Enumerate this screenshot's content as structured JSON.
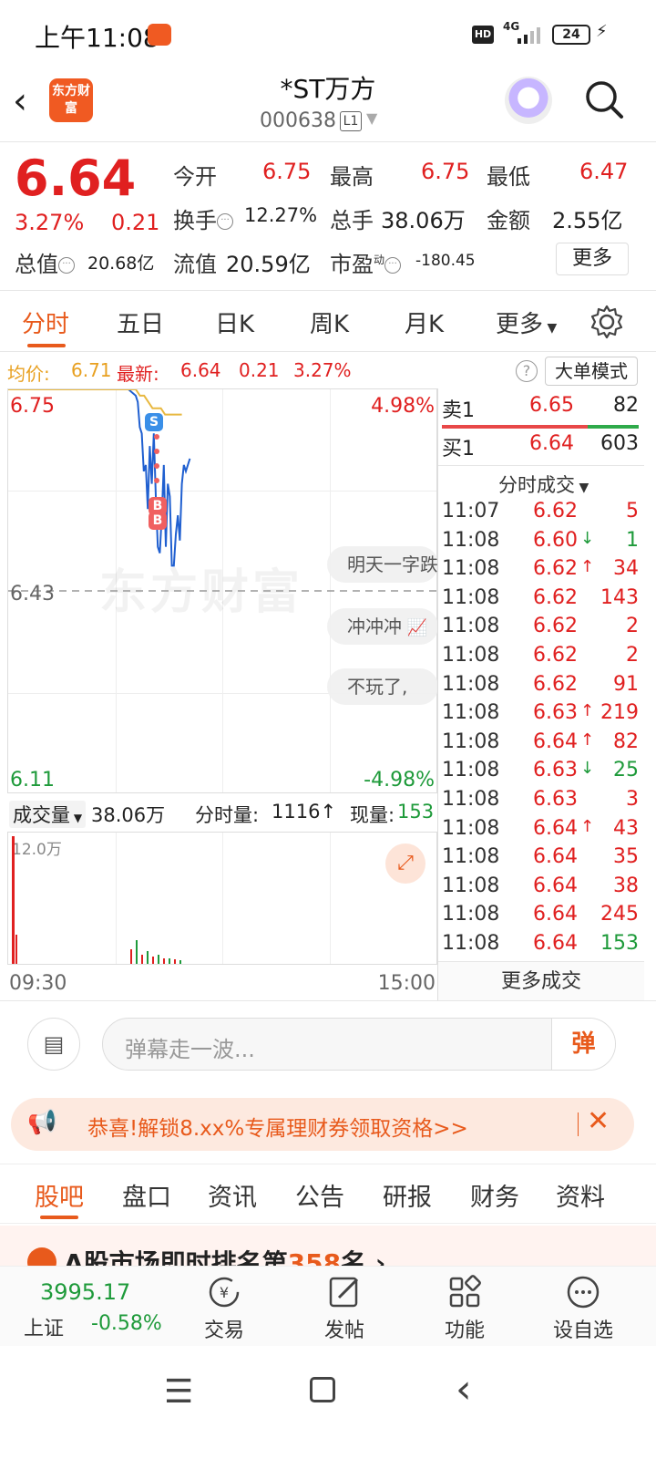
{
  "status": {
    "time": "上午11:08",
    "hd": "HD",
    "network": "4G",
    "battery": "24"
  },
  "header": {
    "logo": "东方财富",
    "name": "*ST万方",
    "code": "000638",
    "level": "L1"
  },
  "quote": {
    "price": "6.64",
    "pct": "3.27%",
    "change": "0.21",
    "open_label": "今开",
    "open": "6.75",
    "high_label": "最高",
    "high": "6.75",
    "low_label": "最低",
    "low": "6.47",
    "turnover_label": "换手",
    "turnover": "12.27%",
    "volume_label": "总手",
    "volume": "38.06万",
    "amount_label": "金额",
    "amount": "2.55亿",
    "mktcap_label": "总值",
    "mktcap": "20.68亿",
    "float_label": "流值",
    "float": "20.59亿",
    "pe_label": "市盈",
    "pe_sup": "动",
    "pe": "-180.45",
    "more": "更多"
  },
  "ktabs": [
    "分时",
    "五日",
    "日K",
    "周K",
    "月K",
    "更多"
  ],
  "avgline": {
    "avg_label": "均价:",
    "avg": "6.71",
    "latest_label": "最新:",
    "latest": "6.64",
    "chg": "0.21",
    "pct": "3.27%",
    "bigorder": "大单模式"
  },
  "chart": {
    "y_top": "6.75",
    "y_mid": "6.43",
    "y_bot": "6.11",
    "pct_top": "4.98%",
    "pct_bot": "-4.98%",
    "watermark": "东方财富",
    "markers": [
      "S",
      "B",
      "B"
    ],
    "comments": [
      "明天一字跌",
      "冲冲冲",
      "不玩了,"
    ]
  },
  "chart_data": {
    "type": "line",
    "ylim": [
      6.11,
      6.75
    ],
    "price": [
      6.75,
      6.75,
      6.75,
      6.75,
      6.75,
      6.75,
      6.75,
      6.74,
      6.73,
      6.69,
      6.68,
      6.62,
      6.63,
      6.56,
      6.66,
      6.6,
      6.68,
      6.58,
      6.5,
      6.49,
      6.55,
      6.63,
      6.5,
      6.6,
      6.58,
      6.47,
      6.47,
      6.52,
      6.55,
      6.51,
      6.6,
      6.63,
      6.62,
      6.63,
      6.64
    ],
    "avg": [
      6.75,
      6.75,
      6.75,
      6.75,
      6.75,
      6.75,
      6.75,
      6.75,
      6.74,
      6.74,
      6.73,
      6.72,
      6.72,
      6.72,
      6.71,
      6.71,
      6.71,
      6.71,
      6.71
    ]
  },
  "volume": {
    "label": "成交量",
    "total": "38.06万",
    "interval_label": "分时量:",
    "interval": "1116",
    "now_label": "现量:",
    "now": "153",
    "scale": "12.0万",
    "t_start": "09:30",
    "t_end": "15:00"
  },
  "book": {
    "sell_label": "卖1",
    "sell_price": "6.65",
    "sell_vol": "82",
    "buy_label": "买1",
    "buy_price": "6.64",
    "buy_vol": "603",
    "ticks_title": "分时成交",
    "ticks": [
      {
        "t": "11:07",
        "p": "6.62",
        "d": "",
        "v": "5",
        "c": "red"
      },
      {
        "t": "11:08",
        "p": "6.60",
        "d": "↓",
        "v": "1",
        "c": "green"
      },
      {
        "t": "11:08",
        "p": "6.62",
        "d": "↑",
        "v": "34",
        "c": "red"
      },
      {
        "t": "11:08",
        "p": "6.62",
        "d": "",
        "v": "143",
        "c": "red"
      },
      {
        "t": "11:08",
        "p": "6.62",
        "d": "",
        "v": "2",
        "c": "red"
      },
      {
        "t": "11:08",
        "p": "6.62",
        "d": "",
        "v": "2",
        "c": "red"
      },
      {
        "t": "11:08",
        "p": "6.62",
        "d": "",
        "v": "91",
        "c": "red"
      },
      {
        "t": "11:08",
        "p": "6.63",
        "d": "↑",
        "v": "219",
        "c": "red"
      },
      {
        "t": "11:08",
        "p": "6.64",
        "d": "↑",
        "v": "82",
        "c": "red"
      },
      {
        "t": "11:08",
        "p": "6.63",
        "d": "↓",
        "v": "25",
        "c": "green"
      },
      {
        "t": "11:08",
        "p": "6.63",
        "d": "",
        "v": "3",
        "c": "red"
      },
      {
        "t": "11:08",
        "p": "6.64",
        "d": "↑",
        "v": "43",
        "c": "red"
      },
      {
        "t": "11:08",
        "p": "6.64",
        "d": "",
        "v": "35",
        "c": "red"
      },
      {
        "t": "11:08",
        "p": "6.64",
        "d": "",
        "v": "38",
        "c": "red"
      },
      {
        "t": "11:08",
        "p": "6.64",
        "d": "",
        "v": "245",
        "c": "red"
      },
      {
        "t": "11:08",
        "p": "6.64",
        "d": "",
        "v": "153",
        "c": "green"
      }
    ],
    "more_ticks": "更多成交"
  },
  "danmaku": {
    "placeholder": "弹幕走一波...",
    "btn": "弹"
  },
  "banner": {
    "text": "恭喜!解锁8.xx%专属理财券领取资格>>"
  },
  "btabs": [
    "股吧",
    "盘口",
    "资讯",
    "公告",
    "研报",
    "财务",
    "资料"
  ],
  "peek": {
    "text_a": "A股市场即时排名第",
    "rank": "358",
    "text_b": "名"
  },
  "bnav": {
    "index": "3995.17",
    "index_name": "上证",
    "index_pct": "-0.58%",
    "items": [
      "交易",
      "发帖",
      "功能",
      "设自选"
    ]
  },
  "colors": {
    "red": "#e02020",
    "green": "#1e9a3a",
    "accent": "#e85a1c",
    "line": "#1f5fd0",
    "avg": "#e8b840"
  }
}
